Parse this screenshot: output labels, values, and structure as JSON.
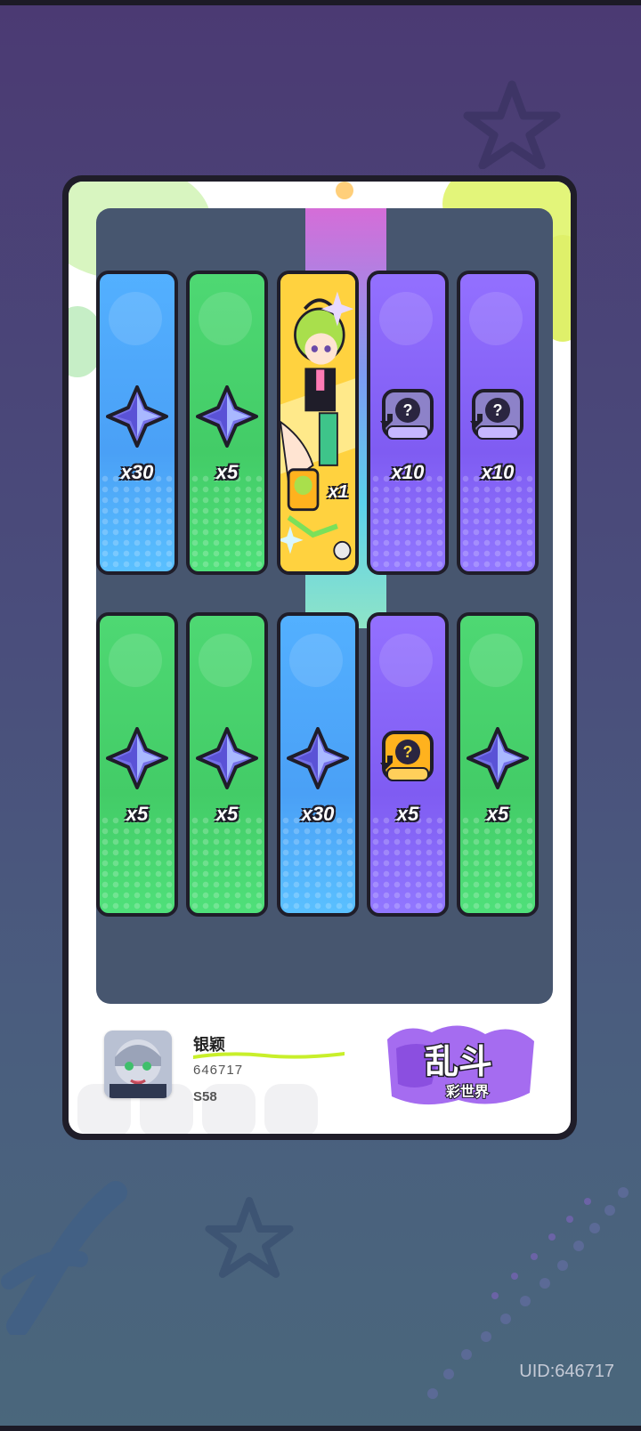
{
  "player": {
    "name": "银颖",
    "id": "646717",
    "server": "S58"
  },
  "uid_label": "UID:646717",
  "logo_text": {
    "main": "乱斗",
    "sub": "彩世界"
  },
  "watermark": "",
  "rows": [
    [
      {
        "color": "blue",
        "item": "star-crystal-icon",
        "qty": "x30"
      },
      {
        "color": "green",
        "item": "star-crystal-icon",
        "qty": "x5"
      },
      {
        "color": "special",
        "item": "character-card",
        "qty": "x1"
      },
      {
        "color": "purple",
        "item": "mystery-ticket-icon",
        "qty": "x10"
      },
      {
        "color": "purple",
        "item": "mystery-ticket-icon",
        "qty": "x10"
      }
    ],
    [
      {
        "color": "green",
        "item": "star-crystal-icon",
        "qty": "x5"
      },
      {
        "color": "green",
        "item": "star-crystal-icon",
        "qty": "x5"
      },
      {
        "color": "blue",
        "item": "star-crystal-icon",
        "qty": "x30"
      },
      {
        "color": "purple",
        "item": "gold-mystery-ticket-icon",
        "qty": "x5"
      },
      {
        "color": "green",
        "item": "star-crystal-icon",
        "qty": "x5"
      }
    ]
  ],
  "colors": {
    "blue": "#4aa0f6",
    "green": "#43cc67",
    "purple": "#7f5cf2",
    "gold": "#ffc233",
    "board": "#47566f"
  }
}
